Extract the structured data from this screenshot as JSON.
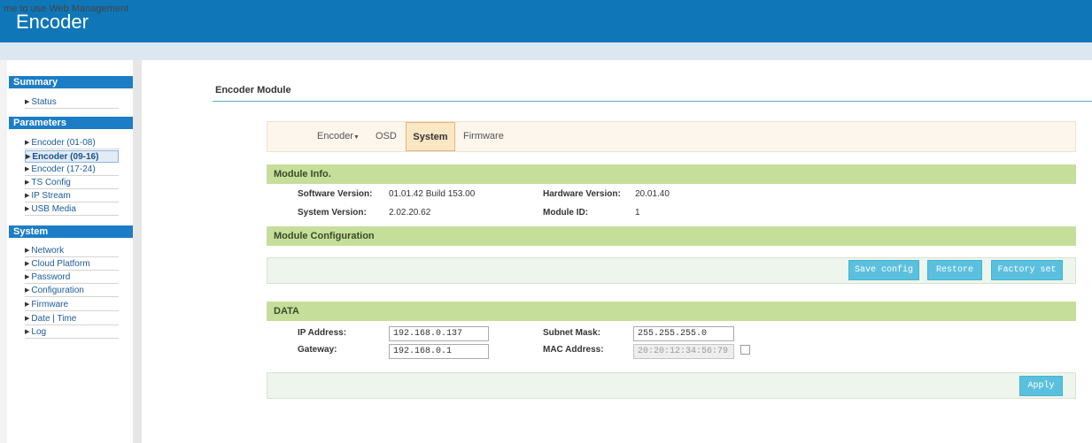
{
  "header": {
    "title": "Encoder"
  },
  "welcome": {
    "text": "me to use Web Management"
  },
  "sidebar": {
    "summary": {
      "title": "Summary",
      "items": [
        {
          "label": "Status"
        }
      ]
    },
    "parameters": {
      "title": "Parameters",
      "items": [
        {
          "label": "Encoder (01-08)"
        },
        {
          "label": "Encoder (09-16)",
          "active": true
        },
        {
          "label": "Encoder (17-24)"
        },
        {
          "label": "TS Config"
        },
        {
          "label": "IP Stream"
        },
        {
          "label": "USB Media"
        }
      ]
    },
    "system": {
      "title": "System",
      "items": [
        {
          "label": "Network"
        },
        {
          "label": "Cloud Platform"
        },
        {
          "label": "Password"
        },
        {
          "label": "Configuration"
        },
        {
          "label": "Firmware"
        },
        {
          "label": "Date | Time"
        },
        {
          "label": "Log"
        }
      ]
    }
  },
  "main": {
    "title": "Encoder Module",
    "tabs": [
      {
        "label": "Encoder",
        "dropdown": true
      },
      {
        "label": "OSD"
      },
      {
        "label": "System",
        "active": true
      },
      {
        "label": "Firmware"
      }
    ],
    "module_info": {
      "title": "Module Info.",
      "software_version_label": "Software Version:",
      "software_version": "01.01.42 Build 153.00",
      "hardware_version_label": "Hardware Version:",
      "hardware_version": "20.01.40",
      "system_version_label": "System Version:",
      "system_version": "2.02.20.62",
      "module_id_label": "Module ID:",
      "module_id": "1"
    },
    "module_config": {
      "title": "Module Configuration",
      "save_label": "Save config",
      "restore_label": "Restore",
      "factory_label": "Factory set"
    },
    "data": {
      "title": "DATA",
      "ip_label": "IP Address:",
      "ip_value": "192.168.0.137",
      "subnet_label": "Subnet Mask:",
      "subnet_value": "255.255.255.0",
      "gateway_label": "Gateway:",
      "gateway_value": "192.168.0.1",
      "mac_label": "MAC Address:",
      "mac_value": "20:20:12:34:56:79",
      "mac_checkbox_checked": false,
      "apply_label": "Apply"
    }
  },
  "colors": {
    "header": "#0f77b8",
    "section_head": "#1c7dc6",
    "green_head": "#c5df9a",
    "button": "#5bc0de",
    "active_tab": "#fbe7c4"
  }
}
